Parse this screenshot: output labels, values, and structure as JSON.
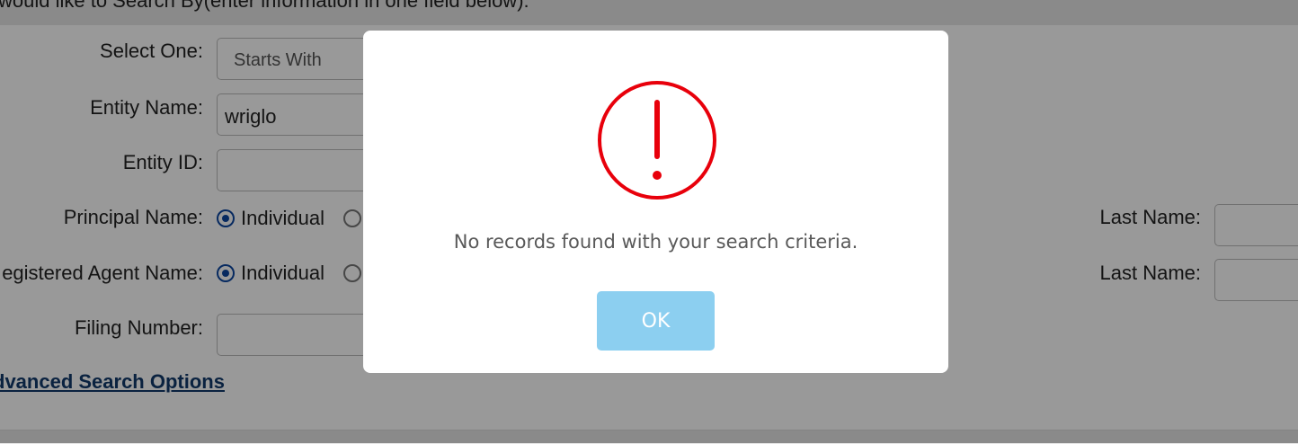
{
  "page": {
    "instruction": "would like to Search By(enter information in one field below):",
    "select_one_label": "Select One:",
    "select_one_value": "Starts With",
    "entity_name_label": "Entity Name:",
    "entity_name_value": "wriglo",
    "entity_id_label": "Entity ID:",
    "principal_name_label": "Principal Name:",
    "principal_option_individual": "Individual",
    "registered_agent_label": "egistered Agent Name:",
    "registered_agent_option_individual": "Individual",
    "filing_number_label": "Filing Number:",
    "last_name_label_1": "Last Name:",
    "last_name_label_2": "Last Name:",
    "advanced_link": "dvanced Search Options"
  },
  "modal": {
    "message": "No records found with your search criteria.",
    "ok_label": "OK",
    "icon": "exclamation-circle-icon",
    "icon_color": "#e8000b",
    "button_color": "#8ccff0"
  }
}
